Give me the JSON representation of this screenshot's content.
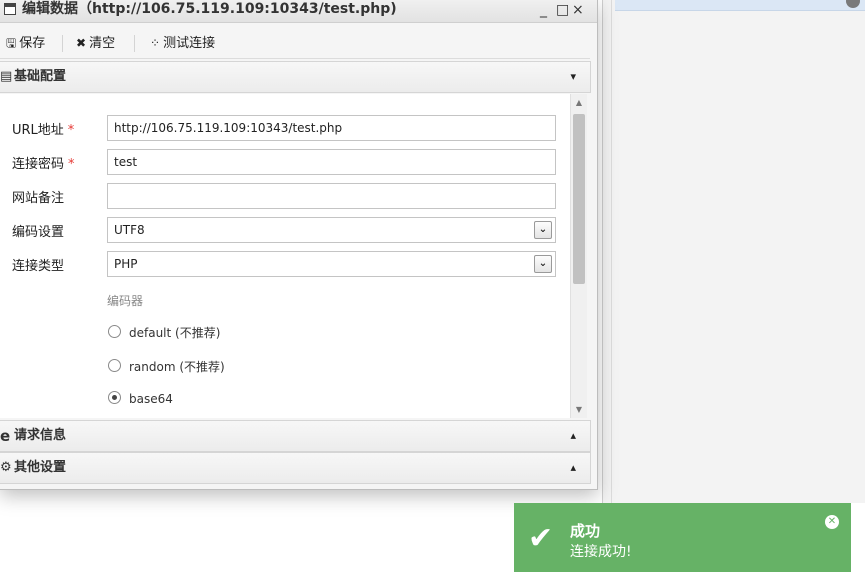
{
  "window": {
    "title": "编辑数据（http://106.75.119.109:10343/test.php)",
    "minimize": "_",
    "maximize": "□",
    "close": "×"
  },
  "toolbar": {
    "save_label": "保存",
    "clear_label": "清空",
    "test_label": "测试连接"
  },
  "sections": {
    "basic": {
      "label": "基础配置",
      "chevron": "⌄"
    },
    "request": {
      "label": "请求信息",
      "chevron": "⌃"
    },
    "other": {
      "label": "其他设置",
      "chevron": "⌃"
    }
  },
  "form": {
    "url": {
      "label": "URL地址",
      "value": "http://106.75.119.109:10343/test.php",
      "required": "*"
    },
    "password": {
      "label": "连接密码",
      "value": "test",
      "required": "*"
    },
    "note": {
      "label": "网站备注",
      "value": ""
    },
    "encoding": {
      "label": "编码设置",
      "value": "UTF8"
    },
    "type": {
      "label": "连接类型",
      "value": "PHP"
    },
    "encoder_group": "编码器",
    "encoders": [
      {
        "label": "default (不推荐)",
        "selected": false
      },
      {
        "label": "random (不推荐)",
        "selected": false
      },
      {
        "label": "base64",
        "selected": true
      }
    ]
  },
  "toast": {
    "title": "成功",
    "message": "连接成功!",
    "color": "#66b266"
  }
}
